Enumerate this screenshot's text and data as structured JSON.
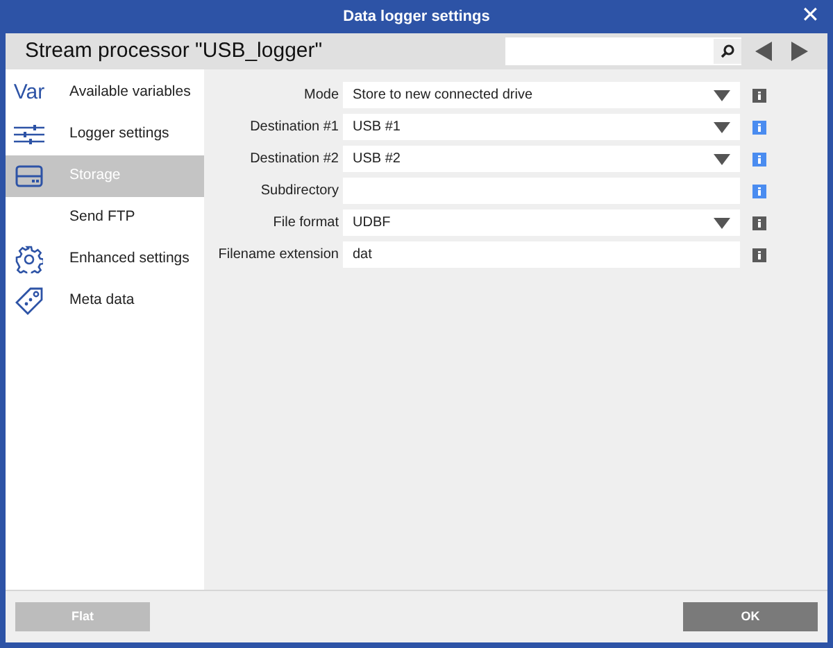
{
  "window": {
    "title": "Data logger settings",
    "close": "✕"
  },
  "header": {
    "title": "Stream processor \"USB_logger\""
  },
  "sidebar": {
    "items": [
      {
        "label": "Available variables",
        "kind": "text-icon",
        "icon_text": "Var",
        "selected": false
      },
      {
        "label": "Logger settings",
        "kind": "sliders",
        "selected": false
      },
      {
        "label": "Storage",
        "kind": "drive",
        "selected": true
      },
      {
        "label": "Send FTP",
        "kind": "none",
        "selected": false
      },
      {
        "label": "Enhanced settings",
        "kind": "gear",
        "selected": false
      },
      {
        "label": "Meta data",
        "kind": "tag",
        "selected": false
      }
    ]
  },
  "form": {
    "fields": [
      {
        "label": "Mode",
        "kind": "dropdown",
        "value": "Store to new connected drive",
        "info_highlighted": false
      },
      {
        "label": "Destination #1",
        "kind": "dropdown",
        "value": "USB #1",
        "info_highlighted": true
      },
      {
        "label": "Destination #2",
        "kind": "dropdown",
        "value": "USB #2",
        "info_highlighted": true
      },
      {
        "label": "Subdirectory",
        "kind": "text",
        "info_highlighted": true
      },
      {
        "label": "File format",
        "kind": "dropdown",
        "value": "UDBF",
        "info_highlighted": false
      },
      {
        "label": "Filename extension",
        "kind": "text",
        "value": "dat",
        "info_highlighted": false
      }
    ]
  },
  "footer": {
    "buttons": [
      {
        "label": "Flat",
        "disabled": true
      },
      {
        "label": "OK",
        "disabled": false
      }
    ]
  }
}
